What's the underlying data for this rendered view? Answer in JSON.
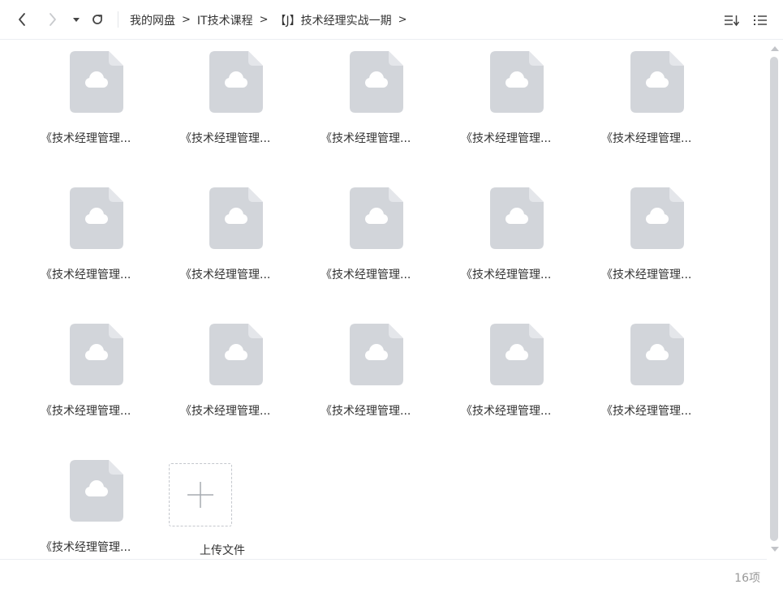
{
  "toolbar": {
    "breadcrumbs": [
      "我的网盘",
      "IT技术课程",
      "【J】技术经理实战一期"
    ],
    "separator": ">"
  },
  "files": [
    {
      "name": "《技术经理管理..."
    },
    {
      "name": "《技术经理管理..."
    },
    {
      "name": "《技术经理管理..."
    },
    {
      "name": "《技术经理管理..."
    },
    {
      "name": "《技术经理管理..."
    },
    {
      "name": "《技术经理管理..."
    },
    {
      "name": "《技术经理管理..."
    },
    {
      "name": "《技术经理管理..."
    },
    {
      "name": "《技术经理管理..."
    },
    {
      "name": "《技术经理管理..."
    },
    {
      "name": "《技术经理管理..."
    },
    {
      "name": "《技术经理管理..."
    },
    {
      "name": "《技术经理管理..."
    },
    {
      "name": "《技术经理管理..."
    },
    {
      "name": "《技术经理管理..."
    },
    {
      "name": "《技术经理管理..."
    }
  ],
  "upload": {
    "label": "上传文件"
  },
  "footer": {
    "count": "16项"
  },
  "colors": {
    "file_icon": "#d2d5da",
    "cloud": "#ffffff",
    "text": "#333333",
    "muted": "#999999"
  },
  "icons": {
    "file": "cloud-file-icon",
    "upload": "plus-icon"
  }
}
